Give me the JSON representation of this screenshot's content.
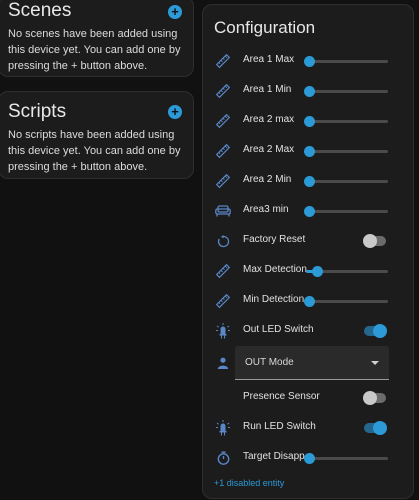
{
  "scenes": {
    "title": "Scenes",
    "add_icon": "plus-circle-icon",
    "empty_text": "No scenes have been added using this device yet. You can add one by pressing the + button above."
  },
  "scripts": {
    "title": "Scripts",
    "add_icon": "plus-circle-icon",
    "empty_text": "No scripts have been added using this device yet. You can add one by pressing the + button above."
  },
  "configuration": {
    "title": "Configuration",
    "rows": [
      {
        "type": "slider",
        "label": "Area 1 Max",
        "icon": "ruler-icon",
        "level": 0.0
      },
      {
        "type": "slider",
        "label": "Area 1 Min",
        "icon": "ruler-icon",
        "level": 0.0
      },
      {
        "type": "slider",
        "label": "Area 2 max",
        "icon": "ruler-icon",
        "level": 0.0
      },
      {
        "type": "slider",
        "label": "Area 2 Max",
        "icon": "ruler-icon",
        "level": 0.0
      },
      {
        "type": "slider",
        "label": "Area 2 Min",
        "icon": "ruler-icon",
        "level": 0.0
      },
      {
        "type": "slider",
        "label": "Area3 min",
        "icon": "sofa-icon",
        "level": 0.0
      },
      {
        "type": "toggle",
        "label": "Factory Reset",
        "icon": "restart-icon",
        "on": false
      },
      {
        "type": "slider",
        "label": "Max Detection...",
        "icon": "ruler-icon",
        "level": 0.1
      },
      {
        "type": "slider",
        "label": "Min Detection...",
        "icon": "ruler-icon",
        "level": 0.0
      },
      {
        "type": "toggle",
        "label": "Out LED Switch",
        "icon": "led-icon",
        "on": true
      },
      {
        "type": "select",
        "label": "OUT Mode",
        "icon": "person-icon"
      },
      {
        "type": "toggle",
        "label": "Presence Sensor",
        "icon": "",
        "on": false
      },
      {
        "type": "toggle",
        "label": "Run LED Switch",
        "icon": "led-icon",
        "on": true
      },
      {
        "type": "slider",
        "label": "Target Disapp...",
        "icon": "timer-icon",
        "level": 0.0
      }
    ],
    "disabled_link": "+1 disabled entity"
  },
  "colors": {
    "accent": "#2b9ad7",
    "background": "#111111",
    "card": "#1c1c1c",
    "icon": "#5a86c5"
  }
}
